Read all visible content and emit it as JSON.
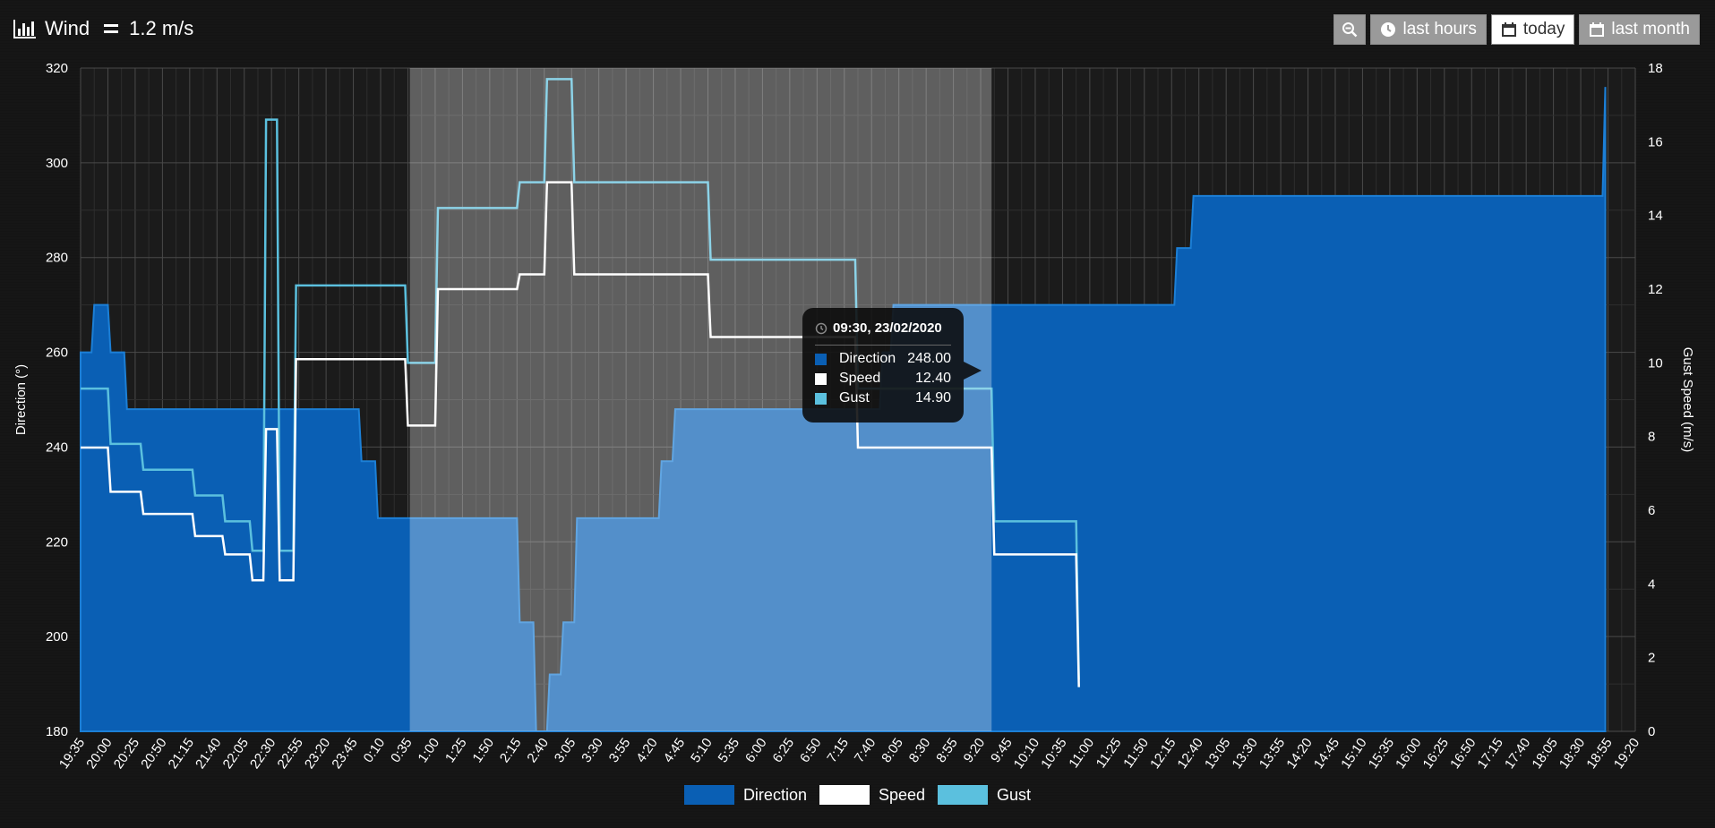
{
  "header": {
    "title": "Wind",
    "value": "1.2 m/s"
  },
  "toolbar": {
    "zoom_icon": "zoom-out-icon",
    "buttons": [
      {
        "label": "last hours",
        "icon": "clock-icon",
        "active": false
      },
      {
        "label": "today",
        "icon": "calendar-icon",
        "active": true
      },
      {
        "label": "last month",
        "icon": "calendar-icon",
        "active": false
      }
    ]
  },
  "tooltip": {
    "time": "09:30, 23/02/2020",
    "rows": [
      {
        "name": "Direction",
        "value": "248.00"
      },
      {
        "name": "Speed",
        "value": "12.40"
      },
      {
        "name": "Gust",
        "value": "14.90"
      }
    ]
  },
  "legend": [
    {
      "name": "Direction",
      "color": "#0a5fb4"
    },
    {
      "name": "Speed",
      "color": "#ffffff"
    },
    {
      "name": "Gust",
      "color": "#5bc0de"
    }
  ],
  "chart_data": {
    "type": "area",
    "xlabel": "",
    "ylabel": "Direction (°)",
    "y2label": "Gust Speed (m/s)",
    "ylim": [
      180,
      320
    ],
    "y2lim": [
      0,
      18
    ],
    "yticks": [
      180,
      200,
      220,
      240,
      260,
      280,
      300,
      320
    ],
    "y2ticks": [
      0,
      2,
      4,
      6,
      8,
      10,
      12,
      14,
      16,
      18
    ],
    "x": [
      "19:35",
      "20:00",
      "20:25",
      "20:50",
      "21:15",
      "21:40",
      "22:05",
      "22:30",
      "22:55",
      "23:20",
      "23:45",
      "0:10",
      "0:35",
      "1:00",
      "1:25",
      "1:50",
      "2:15",
      "2:40",
      "3:05",
      "3:30",
      "3:55",
      "4:20",
      "4:45",
      "5:10",
      "5:35",
      "6:00",
      "6:25",
      "6:50",
      "7:15",
      "7:40",
      "8:05",
      "8:30",
      "8:55",
      "9:20",
      "9:45",
      "10:10",
      "10:35",
      "11:00",
      "11:25",
      "11:50",
      "12:15",
      "12:40",
      "13:05",
      "13:30",
      "13:55",
      "14:20",
      "14:45",
      "15:10",
      "15:35",
      "16:00",
      "16:25",
      "16:50",
      "17:15",
      "17:40",
      "18:05",
      "18:30",
      "18:55",
      "19:20"
    ],
    "highlight_band": {
      "from": "0:35",
      "to": "9:30",
      "color": "#ffffff"
    },
    "series": [
      {
        "name": "Direction",
        "axis": "left",
        "color": "#0a5fb4",
        "type": "area",
        "values": [
          [
            0.0,
            260
          ],
          [
            0.4,
            260
          ],
          [
            0.5,
            270
          ],
          [
            1.0,
            270
          ],
          [
            1.1,
            260
          ],
          [
            1.6,
            260
          ],
          [
            1.7,
            248
          ],
          [
            2.0,
            248
          ],
          [
            3.0,
            248
          ],
          [
            4.0,
            248
          ],
          [
            5.0,
            248
          ],
          [
            6.0,
            248
          ],
          [
            7.0,
            248
          ],
          [
            8.0,
            248
          ],
          [
            9.0,
            248
          ],
          [
            10.0,
            248
          ],
          [
            10.2,
            248
          ],
          [
            10.3,
            237
          ],
          [
            10.8,
            237
          ],
          [
            10.9,
            225
          ],
          [
            11.5,
            225
          ],
          [
            12.0,
            225
          ],
          [
            13.0,
            225
          ],
          [
            14.0,
            225
          ],
          [
            15.0,
            225
          ],
          [
            16.0,
            225
          ],
          [
            16.1,
            203
          ],
          [
            16.6,
            203
          ],
          [
            16.7,
            180
          ],
          [
            17.1,
            180
          ],
          [
            17.2,
            192
          ],
          [
            17.6,
            192
          ],
          [
            17.7,
            203
          ],
          [
            18.1,
            203
          ],
          [
            18.2,
            225
          ],
          [
            19.0,
            225
          ],
          [
            20.0,
            225
          ],
          [
            21.0,
            225
          ],
          [
            21.2,
            225
          ],
          [
            21.3,
            237
          ],
          [
            21.7,
            237
          ],
          [
            21.8,
            248
          ],
          [
            22.0,
            248
          ],
          [
            23.0,
            248
          ],
          [
            24.0,
            248
          ],
          [
            25.0,
            248
          ],
          [
            26.0,
            248
          ],
          [
            27.0,
            248
          ],
          [
            28.0,
            248
          ],
          [
            29.0,
            248
          ],
          [
            29.3,
            248
          ],
          [
            29.4,
            260
          ],
          [
            29.7,
            260
          ],
          [
            29.8,
            270
          ],
          [
            31.0,
            270
          ],
          [
            32.0,
            270
          ],
          [
            33.0,
            270
          ],
          [
            34.0,
            270
          ],
          [
            35.0,
            270
          ],
          [
            36.0,
            270
          ],
          [
            37.0,
            270
          ],
          [
            38.0,
            270
          ],
          [
            39.0,
            270
          ],
          [
            40.0,
            270
          ],
          [
            40.1,
            270
          ],
          [
            40.2,
            282
          ],
          [
            40.7,
            282
          ],
          [
            40.8,
            293
          ],
          [
            42.0,
            293
          ],
          [
            44.0,
            293
          ],
          [
            46.0,
            293
          ],
          [
            48.0,
            293
          ],
          [
            50.0,
            293
          ],
          [
            52.0,
            293
          ],
          [
            54.0,
            293
          ],
          [
            55.0,
            293
          ],
          [
            55.8,
            293
          ],
          [
            55.9,
            316
          ]
        ]
      },
      {
        "name": "Speed",
        "axis": "right",
        "color": "#ffffff",
        "type": "line",
        "values": [
          [
            0.0,
            7.7
          ],
          [
            1.0,
            7.7
          ],
          [
            1.1,
            6.5
          ],
          [
            2.0,
            6.5
          ],
          [
            2.2,
            6.5
          ],
          [
            2.3,
            5.9
          ],
          [
            3.0,
            5.9
          ],
          [
            4.0,
            5.9
          ],
          [
            4.1,
            5.9
          ],
          [
            4.2,
            5.3
          ],
          [
            5.0,
            5.3
          ],
          [
            5.2,
            5.3
          ],
          [
            5.3,
            4.8
          ],
          [
            6.0,
            4.8
          ],
          [
            6.2,
            4.8
          ],
          [
            6.3,
            4.1
          ],
          [
            6.7,
            4.1
          ],
          [
            6.8,
            8.2
          ],
          [
            7.2,
            8.2
          ],
          [
            7.3,
            4.1
          ],
          [
            7.8,
            4.1
          ],
          [
            7.9,
            10.1
          ],
          [
            9.0,
            10.1
          ],
          [
            10.0,
            10.1
          ],
          [
            11.0,
            10.1
          ],
          [
            11.9,
            10.1
          ],
          [
            12.0,
            8.3
          ],
          [
            13.0,
            8.3
          ],
          [
            13.1,
            12.0
          ],
          [
            14.0,
            12.0
          ],
          [
            15.0,
            12.0
          ],
          [
            16.0,
            12.0
          ],
          [
            16.1,
            12.4
          ],
          [
            17.0,
            12.4
          ],
          [
            17.1,
            14.9
          ],
          [
            18.0,
            14.9
          ],
          [
            18.1,
            12.4
          ],
          [
            19.0,
            12.4
          ],
          [
            20.0,
            12.4
          ],
          [
            21.0,
            12.4
          ],
          [
            22.0,
            12.4
          ],
          [
            23.0,
            12.4
          ],
          [
            23.1,
            10.7
          ],
          [
            24.0,
            10.7
          ],
          [
            25.0,
            10.7
          ],
          [
            26.0,
            10.7
          ],
          [
            27.0,
            10.7
          ],
          [
            28.0,
            10.7
          ],
          [
            28.4,
            10.7
          ],
          [
            28.5,
            7.7
          ],
          [
            30.0,
            7.7
          ],
          [
            31.0,
            7.7
          ],
          [
            32.0,
            7.7
          ],
          [
            33.0,
            7.7
          ],
          [
            33.4,
            7.7
          ],
          [
            33.5,
            4.8
          ],
          [
            34.0,
            4.8
          ],
          [
            35.0,
            4.8
          ],
          [
            36.0,
            4.8
          ],
          [
            36.5,
            4.8
          ],
          [
            36.6,
            1.2
          ]
        ]
      },
      {
        "name": "Gust",
        "axis": "right",
        "color": "#5bc0de",
        "type": "line",
        "values": [
          [
            0.0,
            9.3
          ],
          [
            1.0,
            9.3
          ],
          [
            1.1,
            7.8
          ],
          [
            2.0,
            7.8
          ],
          [
            2.2,
            7.8
          ],
          [
            2.3,
            7.1
          ],
          [
            3.0,
            7.1
          ],
          [
            4.0,
            7.1
          ],
          [
            4.1,
            7.1
          ],
          [
            4.2,
            6.4
          ],
          [
            5.0,
            6.4
          ],
          [
            5.2,
            6.4
          ],
          [
            5.3,
            5.7
          ],
          [
            6.0,
            5.7
          ],
          [
            6.2,
            5.7
          ],
          [
            6.3,
            4.9
          ],
          [
            6.7,
            4.9
          ],
          [
            6.8,
            16.6
          ],
          [
            7.2,
            16.6
          ],
          [
            7.3,
            4.9
          ],
          [
            7.8,
            4.9
          ],
          [
            7.9,
            12.1
          ],
          [
            9.0,
            12.1
          ],
          [
            10.0,
            12.1
          ],
          [
            11.0,
            12.1
          ],
          [
            11.9,
            12.1
          ],
          [
            12.0,
            10.0
          ],
          [
            13.0,
            10.0
          ],
          [
            13.1,
            14.2
          ],
          [
            14.0,
            14.2
          ],
          [
            15.0,
            14.2
          ],
          [
            16.0,
            14.2
          ],
          [
            16.1,
            14.9
          ],
          [
            17.0,
            14.9
          ],
          [
            17.1,
            17.7
          ],
          [
            18.0,
            17.7
          ],
          [
            18.1,
            14.9
          ],
          [
            19.0,
            14.9
          ],
          [
            20.0,
            14.9
          ],
          [
            21.0,
            14.9
          ],
          [
            22.0,
            14.9
          ],
          [
            23.0,
            14.9
          ],
          [
            23.1,
            12.8
          ],
          [
            24.0,
            12.8
          ],
          [
            25.0,
            12.8
          ],
          [
            26.0,
            12.8
          ],
          [
            27.0,
            12.8
          ],
          [
            28.0,
            12.8
          ],
          [
            28.4,
            12.8
          ],
          [
            28.5,
            9.3
          ],
          [
            30.0,
            9.3
          ],
          [
            31.0,
            9.3
          ],
          [
            32.0,
            9.3
          ],
          [
            33.0,
            9.3
          ],
          [
            33.4,
            9.3
          ],
          [
            33.5,
            5.7
          ],
          [
            34.0,
            5.7
          ],
          [
            35.0,
            5.7
          ],
          [
            36.0,
            5.7
          ],
          [
            36.5,
            5.7
          ],
          [
            36.6,
            1.4
          ]
        ]
      }
    ],
    "legend_position": "bottom",
    "grid": true
  }
}
